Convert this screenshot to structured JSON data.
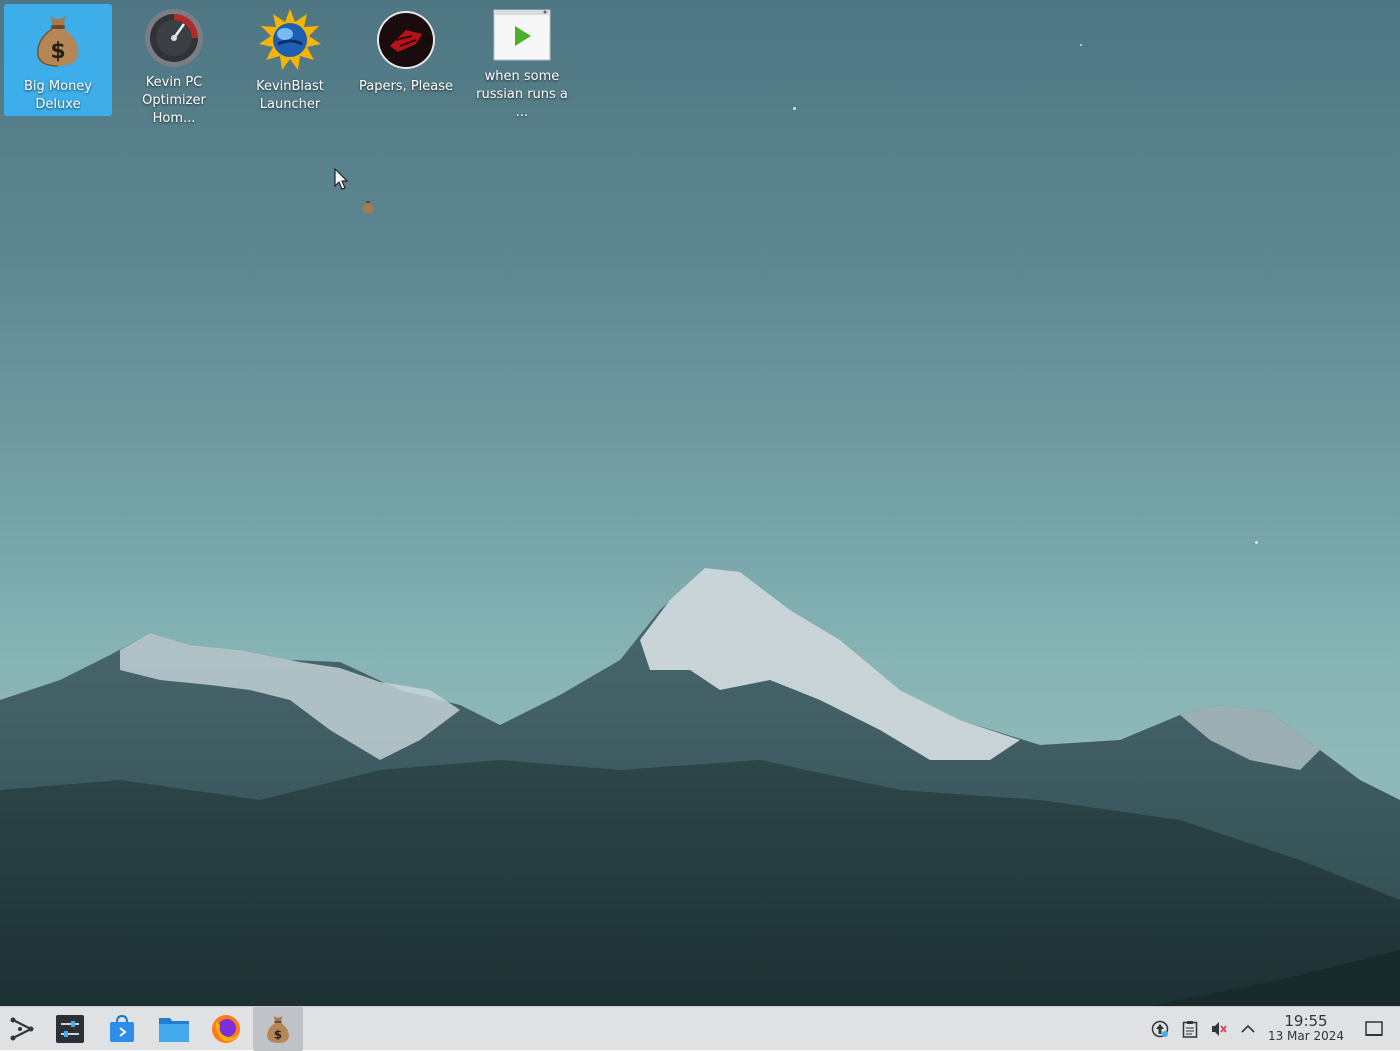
{
  "desktop": {
    "icons": [
      {
        "label": "Big Money\nDeluxe",
        "icon": "money-bag-icon",
        "selected": true
      },
      {
        "label": "Kevin PC\nOptimizer Hom...",
        "icon": "speedometer-icon",
        "selected": false
      },
      {
        "label": "KevinBlast\nLauncher",
        "icon": "globe-sun-icon",
        "selected": false
      },
      {
        "label": "Papers, Please",
        "icon": "papers-please-icon",
        "selected": false
      },
      {
        "label": "when some\nrussian runs a ...",
        "icon": "video-play-icon",
        "selected": false
      }
    ]
  },
  "taskbar": {
    "launchers": [
      "application-launcher-icon",
      "system-settings-icon",
      "discover-store-icon",
      "file-manager-icon",
      "firefox-icon",
      "big-money-deluxe-task-icon"
    ],
    "tray": [
      "update-notifier-icon",
      "clipboard-icon",
      "volume-muted-icon",
      "tray-expand-icon"
    ],
    "clock": {
      "time": "19:55",
      "date": "13 Mar 2024"
    },
    "show_desktop": "show-desktop-icon"
  },
  "colors": {
    "selection": "#3daee9",
    "panel": "#dfe1e3"
  }
}
